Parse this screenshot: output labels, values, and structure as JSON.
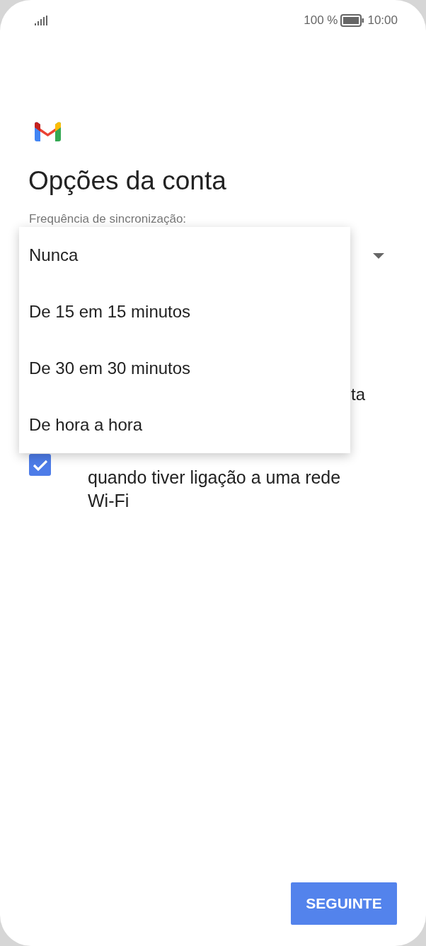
{
  "status_bar": {
    "battery": "100 %",
    "time": "10:00"
  },
  "title": "Opções da conta",
  "sync_frequency": {
    "label": "Frequência de sincronização:",
    "expanded": true
  },
  "menu": [
    {
      "label": "Nunca",
      "selected": false
    },
    {
      "label": "De 15 em 15 minutos",
      "selected": false
    },
    {
      "label": "De 30 em 30 minutos",
      "selected": false
    },
    {
      "label": "De hora a hora",
      "selected": false
    }
  ],
  "hidden_option_fragment": "ta",
  "attachments_option": {
    "label_lines": [
      "quando tiver ligação a uma rede",
      "Wi-Fi"
    ],
    "checked": true
  },
  "next_button": "SEGUINTE"
}
